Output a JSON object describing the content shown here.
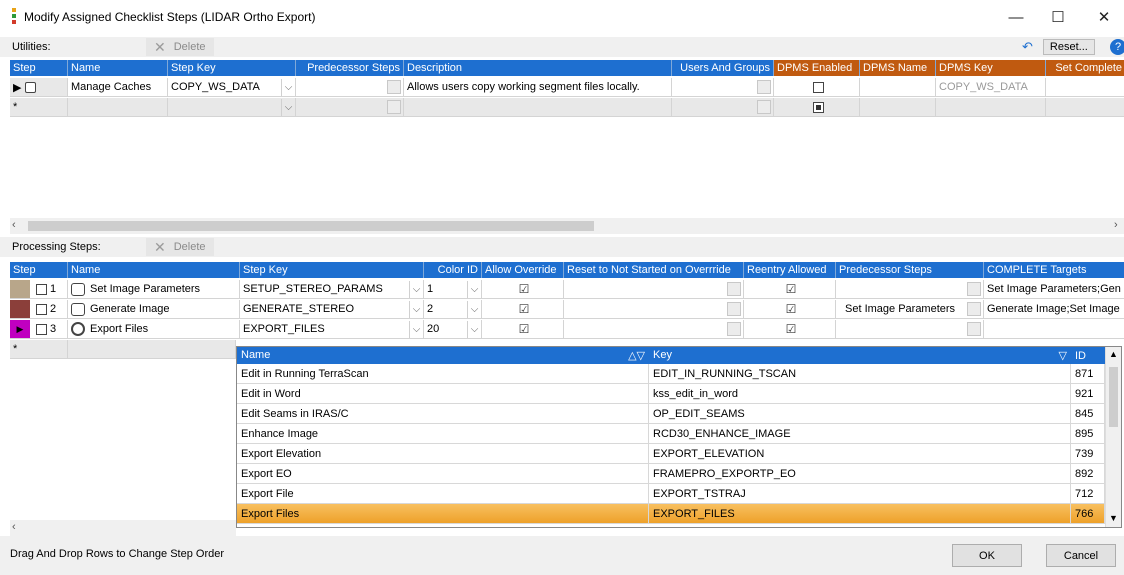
{
  "window": {
    "title": "Modify Assigned Checklist Steps  (LIDAR Ortho Export)",
    "minimize": "—",
    "maximize": "☐",
    "close": "✕"
  },
  "utilities": {
    "label": "Utilities:",
    "delete_label": "Delete",
    "reset_label": "Reset...",
    "columns": [
      "Step",
      "Name",
      "Step Key",
      "Predecessor Steps",
      "Description",
      "Users And Groups",
      "DPMS Enabled",
      "DPMS Name",
      "DPMS Key",
      "Set Complete"
    ],
    "rows": [
      {
        "name": "Manage Caches",
        "step_key": "COPY_WS_DATA",
        "description": "Allows users copy working segment files locally.",
        "dpms_key": "COPY_WS_DATA"
      }
    ],
    "new_row_marker": "*"
  },
  "processing": {
    "label": "Processing Steps:",
    "delete_label": "Delete",
    "columns": [
      "Step",
      "Name",
      "Step Key",
      "Color ID",
      "Allow Override",
      "Reset to Not Started on Overrride",
      "Reentry Allowed",
      "Predecessor Steps",
      "COMPLETE Targets"
    ],
    "rows": [
      {
        "step": "1",
        "name": "Set Image Parameters",
        "step_key": "SETUP_STEREO_PARAMS",
        "color_id": "1",
        "predecessor": "",
        "targets": "Set Image Parameters;Gen",
        "swatch": "#b8a68a"
      },
      {
        "step": "2",
        "name": "Generate Image",
        "step_key": "GENERATE_STEREO",
        "color_id": "2",
        "predecessor": "Set Image Parameters",
        "targets": "Generate Image;Set Image",
        "swatch": "#8b3f3a"
      },
      {
        "step": "3",
        "name": "Export Files",
        "step_key": "EXPORT_FILES",
        "color_id": "20",
        "predecessor": "",
        "targets": "",
        "swatch": "#c000c0"
      }
    ],
    "new_row_marker": "*"
  },
  "lookup": {
    "columns": [
      "Name",
      "Key",
      "ID"
    ],
    "rows": [
      {
        "name": "Edit in Running TerraScan",
        "key": "EDIT_IN_RUNNING_TSCAN",
        "id": "871"
      },
      {
        "name": "Edit in Word",
        "key": "kss_edit_in_word",
        "id": "921"
      },
      {
        "name": "Edit Seams in IRAS/C",
        "key": "OP_EDIT_SEAMS",
        "id": "845"
      },
      {
        "name": "Enhance Image",
        "key": "RCD30_ENHANCE_IMAGE",
        "id": "895"
      },
      {
        "name": "Export Elevation",
        "key": "EXPORT_ELEVATION",
        "id": "739"
      },
      {
        "name": "Export EO",
        "key": "FRAMEPRO_EXPORTP_EO",
        "id": "892"
      },
      {
        "name": "Export File",
        "key": "EXPORT_TSTRAJ",
        "id": "712"
      },
      {
        "name": "Export Files",
        "key": "EXPORT_FILES",
        "id": "766"
      }
    ]
  },
  "footer": {
    "hint": "Drag And Drop Rows to Change Step Order",
    "ok_label": "OK",
    "cancel_label": "Cancel"
  }
}
